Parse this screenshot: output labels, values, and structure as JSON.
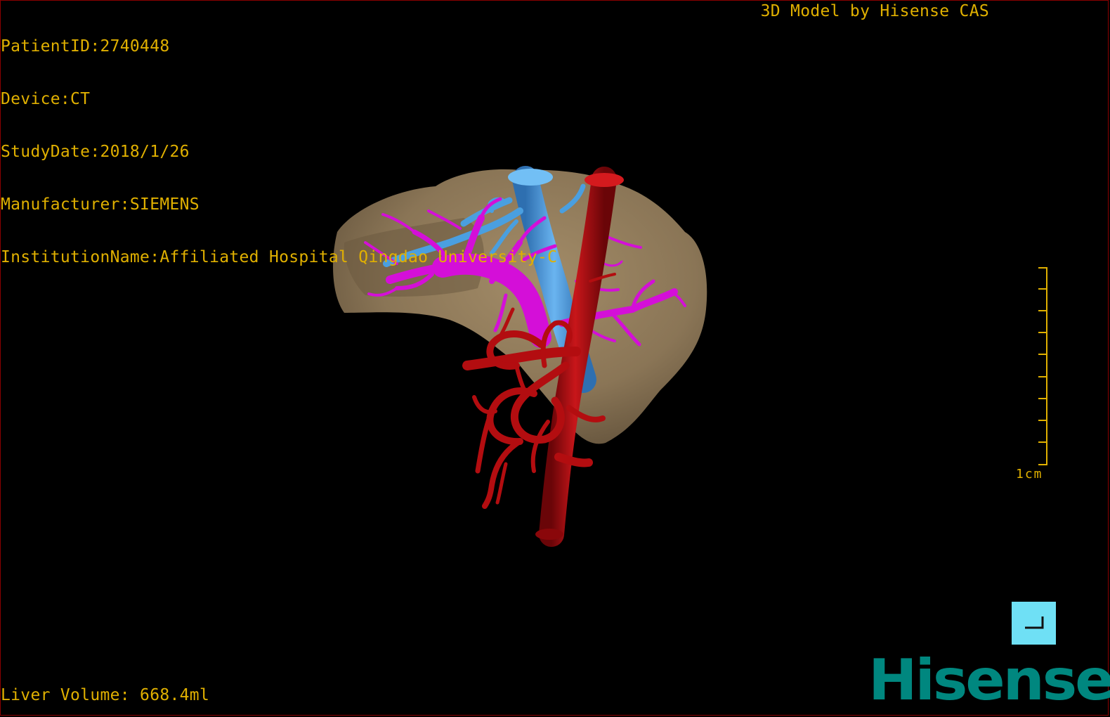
{
  "header": {
    "patient_id": "PatientID:2740448",
    "device": "Device:CT",
    "study_date": "StudyDate:2018/1/26",
    "manufacturer": "Manufacturer:SIEMENS",
    "institution": "InstitutionName:Affiliated Hospital Qingdao University-C"
  },
  "credit": "3D Model by Hisense CAS",
  "footer": {
    "liver_volume": "Liver Volume: 668.4ml"
  },
  "scale": {
    "label": "1cm"
  },
  "brand": {
    "logo": "Hisense"
  },
  "colors": {
    "overlay_text": "#e0b000",
    "liver": "#8a7556",
    "portal_vein": "#d40fd8",
    "hepatic_vein": "#4a9fe0",
    "artery": "#b30d10",
    "orient_button": "#6fe0f5",
    "logo": "#00877f"
  },
  "icons": {
    "orientation": "reset-orientation-icon"
  }
}
